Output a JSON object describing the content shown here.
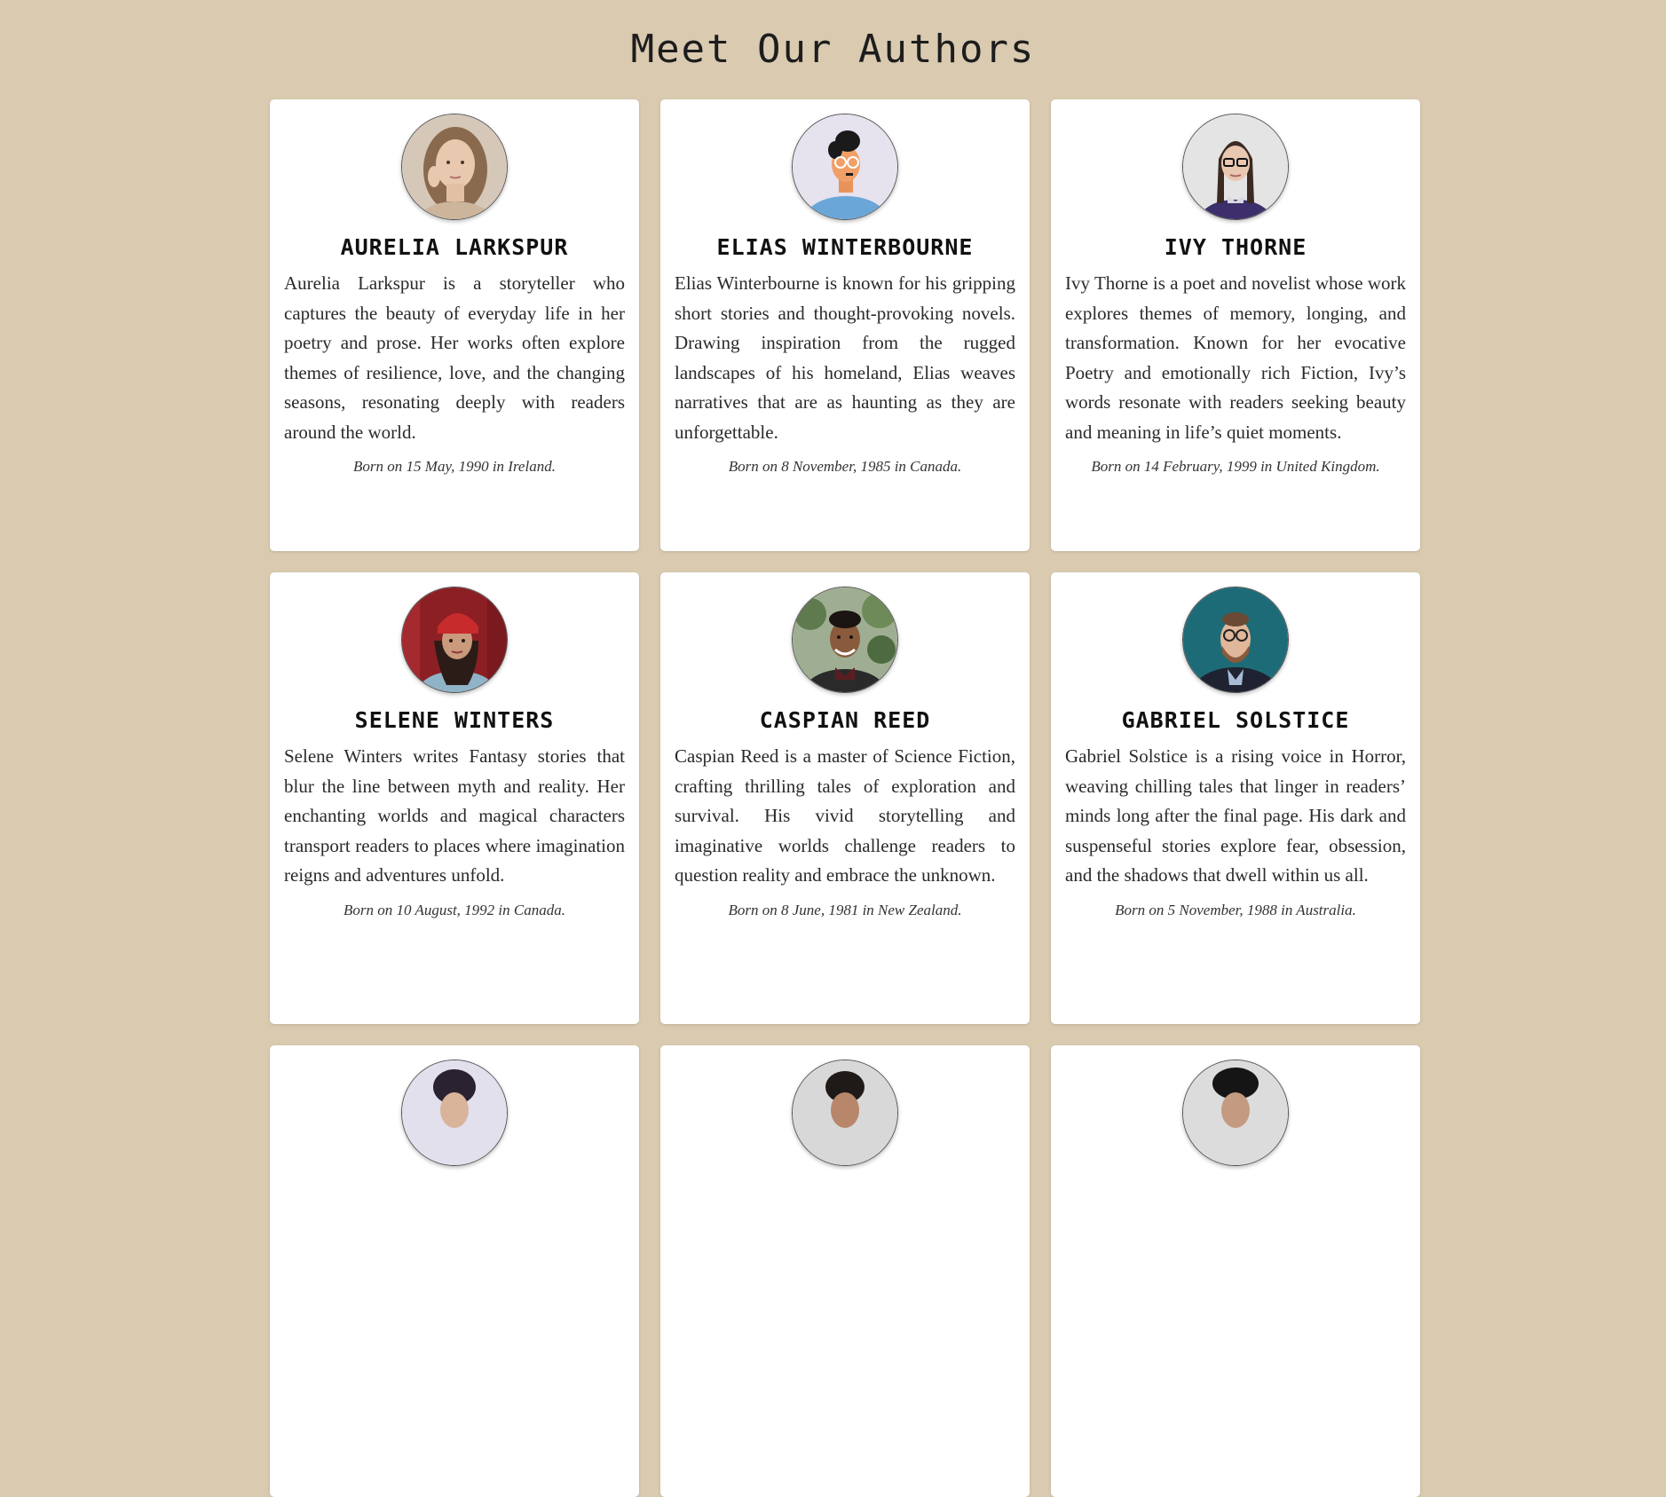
{
  "page": {
    "title": "Meet Our Authors",
    "background": "#d9cab0"
  },
  "authors": [
    {
      "name": "Aurelia Larkspur",
      "bio": "Aurelia Larkspur is a storyteller who captures the beauty of everyday life in her poetry and prose. Her works often explore themes of resilience, love, and the changing seasons, resonating deeply with readers around the world.",
      "born": "Born on 15 May, 1990 in Ireland.",
      "avatar": "portrait-photo-woman-long-hair"
    },
    {
      "name": "Elias Winterbourne",
      "bio": "Elias Winterbourne is known for his gripping short stories and thought-provoking novels. Drawing inspiration from the rugged landscapes of his homeland, Elias weaves narratives that are as haunting as they are unforgettable.",
      "born": "Born on 8 November, 1985 in Canada.",
      "avatar": "illustrated-man-with-glasses"
    },
    {
      "name": "Ivy Thorne",
      "bio": "Ivy Thorne is a poet and novelist whose work explores themes of memory, longing, and transformation. Known for her evocative Poetry and emotionally rich Fiction, Ivy’s words resonate with readers seeking beauty and meaning in life’s quiet moments.",
      "born": "Born on 14 February, 1999 in United Kingdom.",
      "avatar": "portrait-photo-woman-glasses-braids"
    },
    {
      "name": "Selene Winters",
      "bio": "Selene Winters writes Fantasy stories that blur the line between myth and reality. Her enchanting worlds and magical characters transport readers to places where imagination reigns and adventures unfold.",
      "born": "Born on 10 August, 1992 in Canada.",
      "avatar": "portrait-photo-woman-red-beanie"
    },
    {
      "name": "Caspian Reed",
      "bio": "Caspian Reed is a master of Science Fiction, crafting thrilling tales of exploration and survival. His vivid storytelling and imaginative worlds challenge readers to question reality and embrace the unknown.",
      "born": "Born on 8 June, 1981 in New Zealand.",
      "avatar": "portrait-photo-man-smiling-plants"
    },
    {
      "name": "Gabriel Solstice",
      "bio": "Gabriel Solstice is a rising voice in Horror, weaving chilling tales that linger in readers’ minds long after the final page. His dark and suspenseful stories explore fear, obsession, and the shadows that dwell within us all.",
      "born": "Born on 5 November, 1988 in Australia.",
      "avatar": "portrait-photo-man-beard-glasses"
    },
    {
      "name": "",
      "bio": "",
      "born": "",
      "avatar": "portrait-photo-partial"
    },
    {
      "name": "",
      "bio": "",
      "born": "",
      "avatar": "portrait-photo-partial"
    },
    {
      "name": "",
      "bio": "",
      "born": "",
      "avatar": "portrait-photo-partial"
    }
  ]
}
